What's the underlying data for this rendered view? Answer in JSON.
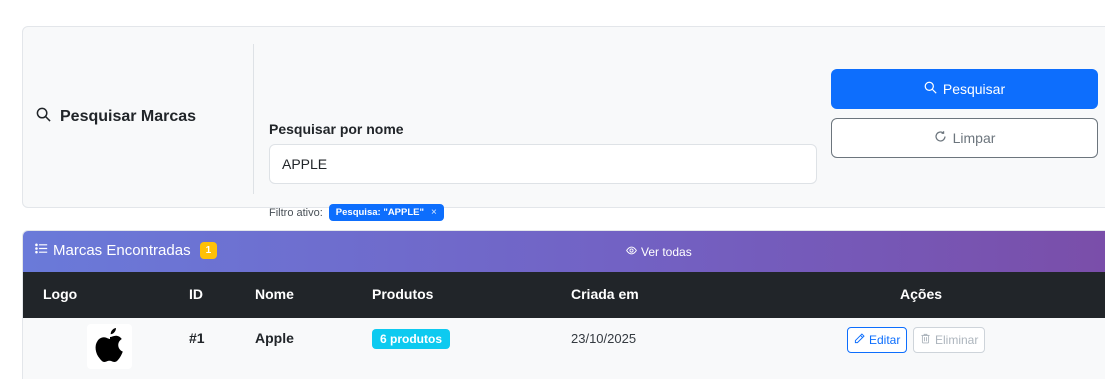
{
  "search": {
    "heading": "Pesquisar Marcas",
    "field_label": "Pesquisar por nome",
    "input_value": "APPLE",
    "filter_label": "Filtro ativo:",
    "filter_badge": "Pesquisa: \"APPLE\"",
    "filter_remove": "×",
    "search_button": "Pesquisar",
    "clear_button": "Limpar"
  },
  "results": {
    "title": "Marcas Encontradas",
    "count": "1",
    "view_all": "Ver todas",
    "columns": [
      "Logo",
      "ID",
      "Nome",
      "Produtos",
      "Criada em",
      "Ações"
    ],
    "rows": [
      {
        "logo": "apple-logo",
        "id": "#1",
        "name": "Apple",
        "products": "6 produtos",
        "created": "23/10/2025",
        "edit": "Editar",
        "delete": "Eliminar"
      }
    ]
  },
  "colors": {
    "primary": "#0d6efd",
    "info": "#0dcaf0",
    "warning": "#ffc107",
    "table_head": "#212529",
    "header_gradient_start": "#6a7ad9",
    "header_gradient_end": "#7a4ea9"
  },
  "icons": {
    "heading": "search-icon",
    "search_button": "search-icon",
    "clear_button": "refresh-icon",
    "results_title": "list-icon",
    "view_all": "eye-icon",
    "edit": "pencil-icon",
    "delete": "trash-icon"
  }
}
